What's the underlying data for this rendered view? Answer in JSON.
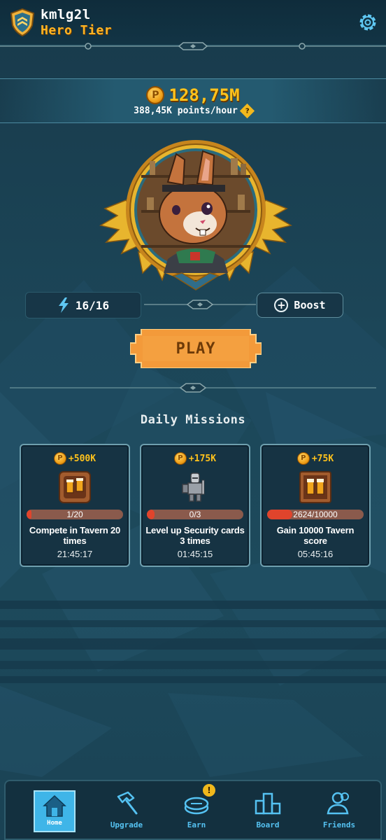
{
  "header": {
    "username": "kmlg2l",
    "tier": "Hero Tier"
  },
  "points": {
    "total": "128,75M",
    "rate": "388,45K points/hour",
    "help_glyph": "?"
  },
  "energy": {
    "value": "16/16"
  },
  "boost": {
    "label": "Boost"
  },
  "play": {
    "label": "PLAY"
  },
  "missions": {
    "title": "Daily Missions",
    "items": [
      {
        "reward": "+500K",
        "progress_text": "1/20",
        "progress": 0.05,
        "title": "Compete in Tavern 20 times",
        "time": "21:45:17",
        "icon": "beer-mugs-icon"
      },
      {
        "reward": "+175K",
        "progress_text": "0/3",
        "progress": 0.0,
        "title": "Level up Security cards 3 times",
        "time": "01:45:15",
        "icon": "knight-icon"
      },
      {
        "reward": "+75K",
        "progress_text": "2624/10000",
        "progress": 0.2624,
        "title": "Gain 10000 Tavern score",
        "time": "05:45:16",
        "icon": "beer-mugs-icon"
      }
    ]
  },
  "nav": {
    "home": "Home",
    "upgrade": "Upgrade",
    "earn": "Earn",
    "board": "Board",
    "friends": "Friends",
    "earn_badge": "!"
  },
  "colors": {
    "accent_gold": "#ffc21c",
    "tier_orange": "#ffb424",
    "play_orange": "#f39a3a",
    "nav_blue": "#55c2f2",
    "progress_red": "#e0442c"
  }
}
